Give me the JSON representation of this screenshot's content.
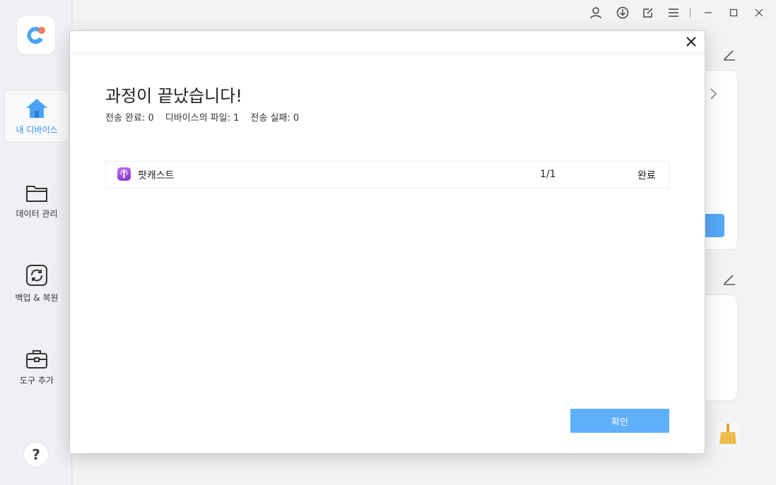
{
  "sidebar": {
    "items": [
      {
        "label": "내 디바이스",
        "icon": "home-icon",
        "active": true
      },
      {
        "label": "데이터 관리",
        "icon": "folder-icon",
        "active": false
      },
      {
        "label": "백업 & 복원",
        "icon": "backup-restore-icon",
        "active": false
      },
      {
        "label": "도구 추가",
        "icon": "toolbox-icon",
        "active": false
      }
    ],
    "help_label": "?"
  },
  "topbar": {
    "icons": [
      "user-icon",
      "download-icon",
      "feedback-icon",
      "menu-icon",
      "minimize-icon",
      "maximize-icon",
      "close-icon"
    ]
  },
  "modal": {
    "title": "과정이 끝났습니다!",
    "stats": {
      "transferred": "전송 완료: 0",
      "device_files": "디바이스의 파일: 1",
      "failed": "전송 실패: 0"
    },
    "rows": [
      {
        "name": "팟캐스트",
        "count": "1/1",
        "status": "완료",
        "icon": "podcast-icon"
      }
    ],
    "confirm_label": "확인"
  },
  "colors": {
    "accent": "#2f8ef0",
    "button": "#5fb0fa",
    "podcast": "#9b4fd9"
  }
}
